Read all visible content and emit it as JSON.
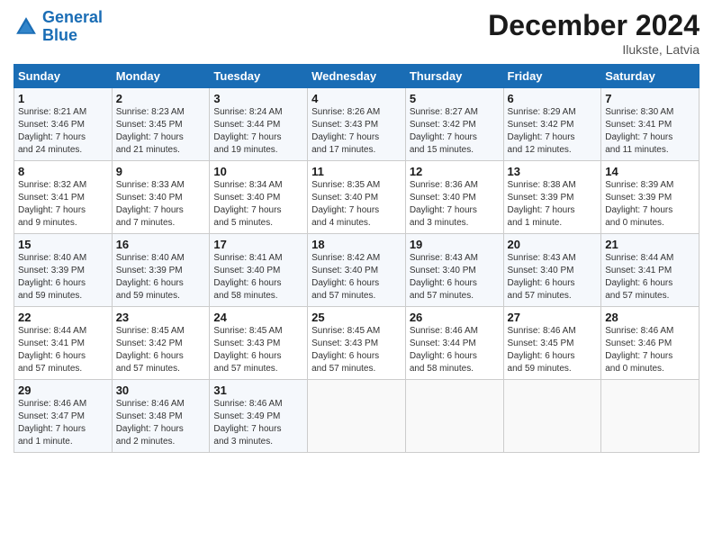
{
  "logo": {
    "line1": "General",
    "line2": "Blue"
  },
  "title": "December 2024",
  "subtitle": "Ilukste, Latvia",
  "days_of_week": [
    "Sunday",
    "Monday",
    "Tuesday",
    "Wednesday",
    "Thursday",
    "Friday",
    "Saturday"
  ],
  "weeks": [
    [
      {
        "day": "1",
        "info": "Sunrise: 8:21 AM\nSunset: 3:46 PM\nDaylight: 7 hours\nand 24 minutes."
      },
      {
        "day": "2",
        "info": "Sunrise: 8:23 AM\nSunset: 3:45 PM\nDaylight: 7 hours\nand 21 minutes."
      },
      {
        "day": "3",
        "info": "Sunrise: 8:24 AM\nSunset: 3:44 PM\nDaylight: 7 hours\nand 19 minutes."
      },
      {
        "day": "4",
        "info": "Sunrise: 8:26 AM\nSunset: 3:43 PM\nDaylight: 7 hours\nand 17 minutes."
      },
      {
        "day": "5",
        "info": "Sunrise: 8:27 AM\nSunset: 3:42 PM\nDaylight: 7 hours\nand 15 minutes."
      },
      {
        "day": "6",
        "info": "Sunrise: 8:29 AM\nSunset: 3:42 PM\nDaylight: 7 hours\nand 12 minutes."
      },
      {
        "day": "7",
        "info": "Sunrise: 8:30 AM\nSunset: 3:41 PM\nDaylight: 7 hours\nand 11 minutes."
      }
    ],
    [
      {
        "day": "8",
        "info": "Sunrise: 8:32 AM\nSunset: 3:41 PM\nDaylight: 7 hours\nand 9 minutes."
      },
      {
        "day": "9",
        "info": "Sunrise: 8:33 AM\nSunset: 3:40 PM\nDaylight: 7 hours\nand 7 minutes."
      },
      {
        "day": "10",
        "info": "Sunrise: 8:34 AM\nSunset: 3:40 PM\nDaylight: 7 hours\nand 5 minutes."
      },
      {
        "day": "11",
        "info": "Sunrise: 8:35 AM\nSunset: 3:40 PM\nDaylight: 7 hours\nand 4 minutes."
      },
      {
        "day": "12",
        "info": "Sunrise: 8:36 AM\nSunset: 3:40 PM\nDaylight: 7 hours\nand 3 minutes."
      },
      {
        "day": "13",
        "info": "Sunrise: 8:38 AM\nSunset: 3:39 PM\nDaylight: 7 hours\nand 1 minute."
      },
      {
        "day": "14",
        "info": "Sunrise: 8:39 AM\nSunset: 3:39 PM\nDaylight: 7 hours\nand 0 minutes."
      }
    ],
    [
      {
        "day": "15",
        "info": "Sunrise: 8:40 AM\nSunset: 3:39 PM\nDaylight: 6 hours\nand 59 minutes."
      },
      {
        "day": "16",
        "info": "Sunrise: 8:40 AM\nSunset: 3:39 PM\nDaylight: 6 hours\nand 59 minutes."
      },
      {
        "day": "17",
        "info": "Sunrise: 8:41 AM\nSunset: 3:40 PM\nDaylight: 6 hours\nand 58 minutes."
      },
      {
        "day": "18",
        "info": "Sunrise: 8:42 AM\nSunset: 3:40 PM\nDaylight: 6 hours\nand 57 minutes."
      },
      {
        "day": "19",
        "info": "Sunrise: 8:43 AM\nSunset: 3:40 PM\nDaylight: 6 hours\nand 57 minutes."
      },
      {
        "day": "20",
        "info": "Sunrise: 8:43 AM\nSunset: 3:40 PM\nDaylight: 6 hours\nand 57 minutes."
      },
      {
        "day": "21",
        "info": "Sunrise: 8:44 AM\nSunset: 3:41 PM\nDaylight: 6 hours\nand 57 minutes."
      }
    ],
    [
      {
        "day": "22",
        "info": "Sunrise: 8:44 AM\nSunset: 3:41 PM\nDaylight: 6 hours\nand 57 minutes."
      },
      {
        "day": "23",
        "info": "Sunrise: 8:45 AM\nSunset: 3:42 PM\nDaylight: 6 hours\nand 57 minutes."
      },
      {
        "day": "24",
        "info": "Sunrise: 8:45 AM\nSunset: 3:43 PM\nDaylight: 6 hours\nand 57 minutes."
      },
      {
        "day": "25",
        "info": "Sunrise: 8:45 AM\nSunset: 3:43 PM\nDaylight: 6 hours\nand 57 minutes."
      },
      {
        "day": "26",
        "info": "Sunrise: 8:46 AM\nSunset: 3:44 PM\nDaylight: 6 hours\nand 58 minutes."
      },
      {
        "day": "27",
        "info": "Sunrise: 8:46 AM\nSunset: 3:45 PM\nDaylight: 6 hours\nand 59 minutes."
      },
      {
        "day": "28",
        "info": "Sunrise: 8:46 AM\nSunset: 3:46 PM\nDaylight: 7 hours\nand 0 minutes."
      }
    ],
    [
      {
        "day": "29",
        "info": "Sunrise: 8:46 AM\nSunset: 3:47 PM\nDaylight: 7 hours\nand 1 minute."
      },
      {
        "day": "30",
        "info": "Sunrise: 8:46 AM\nSunset: 3:48 PM\nDaylight: 7 hours\nand 2 minutes."
      },
      {
        "day": "31",
        "info": "Sunrise: 8:46 AM\nSunset: 3:49 PM\nDaylight: 7 hours\nand 3 minutes."
      },
      {
        "day": "",
        "info": ""
      },
      {
        "day": "",
        "info": ""
      },
      {
        "day": "",
        "info": ""
      },
      {
        "day": "",
        "info": ""
      }
    ]
  ]
}
